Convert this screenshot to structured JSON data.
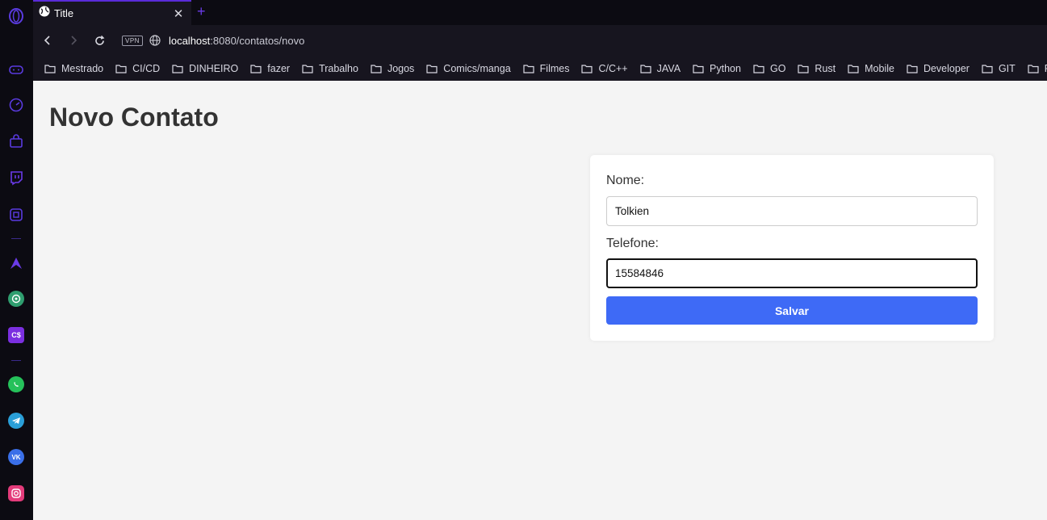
{
  "browser": {
    "tab_title": "Title",
    "tab_close": "✕",
    "new_tab": "+",
    "vpn_label": "VPN",
    "url_host": "localhost",
    "url_path": ":8080/contatos/novo",
    "bookmarks": [
      "Mestrado",
      "CI/CD",
      "DINHEIRO",
      "fazer",
      "Trabalho",
      "Jogos",
      "Comics/manga",
      "Filmes",
      "C/C++",
      "JAVA",
      "Python",
      "GO",
      "Rust",
      "Mobile",
      "Developer",
      "GIT",
      "Profess"
    ]
  },
  "sidebar": {
    "icons": [
      "opera-logo-icon",
      "gamepad-icon",
      "speed-dial-icon",
      "bag-icon",
      "twitch-icon",
      "extensions-icon",
      "aria-icon",
      "chatgpt-icon",
      "cs-icon",
      "whatsapp-icon",
      "telegram-icon",
      "vk-icon",
      "instagram-icon"
    ]
  },
  "page": {
    "title": "Novo Contato",
    "form": {
      "nome_label": "Nome:",
      "nome_value": "Tolkien",
      "telefone_label": "Telefone:",
      "telefone_value": "15584846",
      "submit_label": "Salvar"
    }
  },
  "colors": {
    "accent": "#3e6af6",
    "browser_accent": "#5a2bd9",
    "page_bg": "#f4f4f4"
  }
}
